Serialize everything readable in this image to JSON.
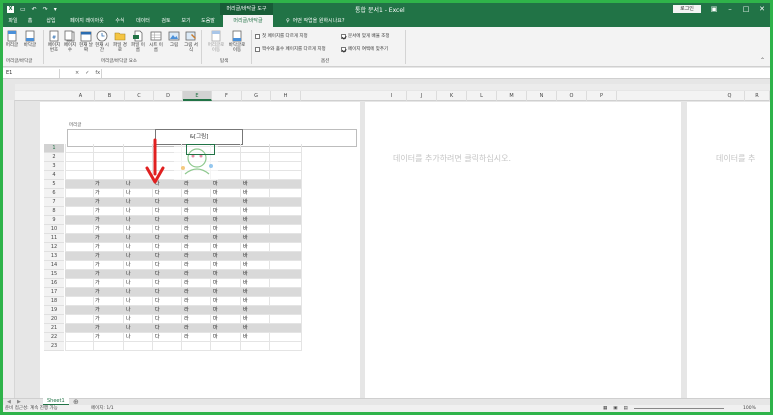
{
  "window": {
    "title": "통합 문서1 - Excel",
    "context_tool": "머리글/바닥글 도구",
    "login": "로그인"
  },
  "tabs": [
    "파일",
    "홈",
    "삽입",
    "페이지 레이아웃",
    "수식",
    "데이터",
    "검토",
    "보기",
    "도움말",
    "머리글/바닥글"
  ],
  "tell_me": "어떤 작업을 원하시나요?",
  "ribbon": {
    "group1": {
      "btn1": "머리글",
      "btn2": "바닥글",
      "label": "머리글/바닥글"
    },
    "group2": {
      "btns": [
        "페이지 번호",
        "페이지 수",
        "현재 날짜",
        "현재 시간",
        "파일 경로",
        "파일 이름",
        "시트 이름",
        "그림",
        "그림 서식"
      ],
      "label": "머리글/바닥글 요소"
    },
    "group3": {
      "btns": [
        "머리글로 이동",
        "바닥글로 이동"
      ],
      "label": "탐색"
    },
    "group4": {
      "checks": [
        {
          "label": "첫 페이지를 다르게 지정",
          "checked": false
        },
        {
          "label": "짝수와 홀수 페이지를 다르게 지정",
          "checked": false
        },
        {
          "label": "문서에 맞게 배율 조정",
          "checked": true
        },
        {
          "label": "페이지 여백에 맞추기",
          "checked": true
        }
      ],
      "label": "옵션"
    }
  },
  "formula_bar": {
    "name_box": "E1",
    "icons": [
      "×",
      "✓",
      "fx"
    ]
  },
  "columns_left": [
    "A",
    "B",
    "C",
    "D",
    "E",
    "F",
    "G",
    "H"
  ],
  "columns_mid": [
    "I",
    "J",
    "K",
    "L",
    "M",
    "N",
    "O",
    "P"
  ],
  "columns_right": [
    "Q",
    "R"
  ],
  "header": {
    "label": "머리글",
    "center": "&[그림]"
  },
  "rows": [
    "1",
    "2",
    "3",
    "4",
    "5",
    "6",
    "7",
    "8",
    "9",
    "10",
    "11",
    "12",
    "13",
    "14",
    "15",
    "16",
    "17",
    "18",
    "19",
    "20",
    "21",
    "22",
    "23"
  ],
  "data_row": [
    "가",
    "나",
    "다",
    "라",
    "마",
    "바"
  ],
  "placeholders": [
    "데이터를 추가하려면 클릭하십시오.",
    "데이터를 추"
  ],
  "sheet_tab": "Sheet1",
  "status": {
    "left": "준비  접근성: 계속 진행 가능",
    "page": "페이지: 1/1",
    "zoom": "100%"
  },
  "colors": {
    "accent": "#217346",
    "frame": "#2fb34a",
    "arrow": "#e02020"
  }
}
